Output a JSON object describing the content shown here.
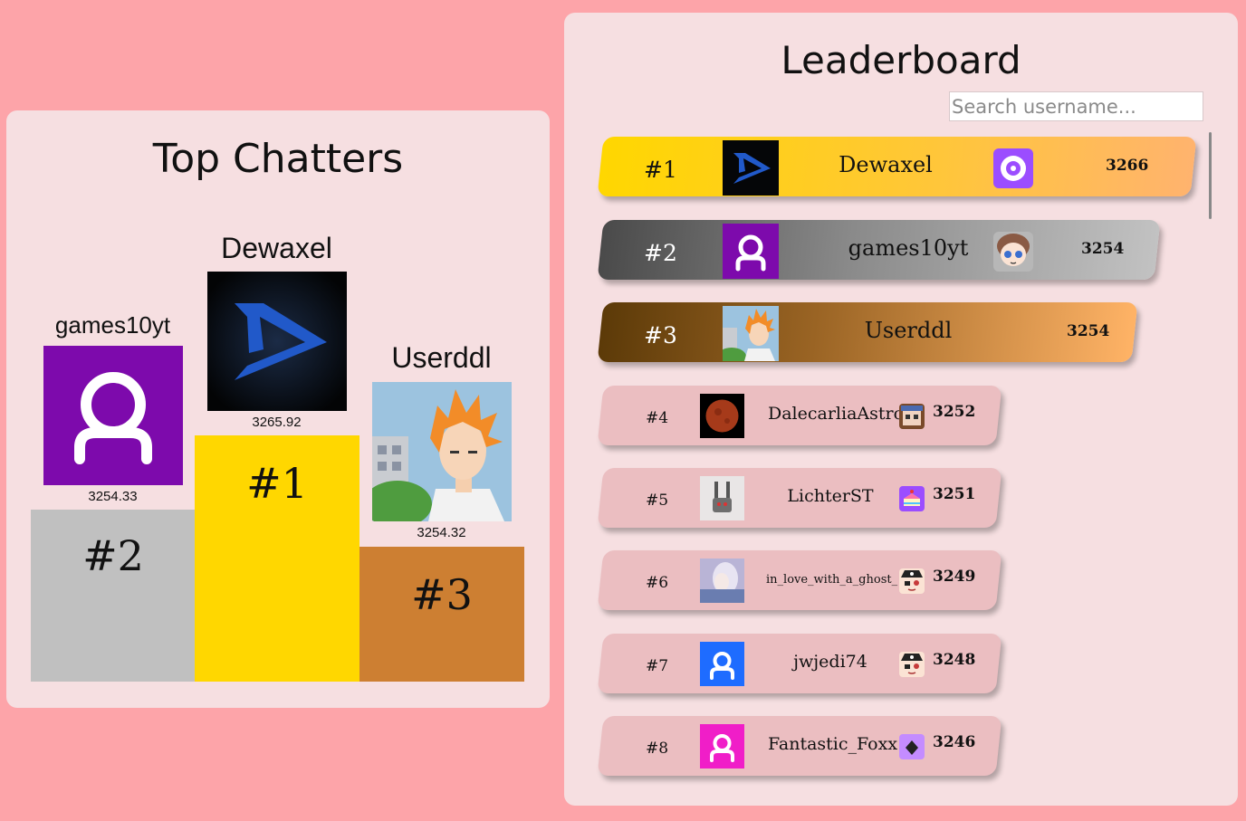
{
  "top_chatters": {
    "title": "Top Chatters",
    "podium": [
      {
        "place": "#2",
        "name": "games10yt",
        "score": "3254.33",
        "block_color": "#c0c0c0"
      },
      {
        "place": "#1",
        "name": "Dewaxel",
        "score": "3265.92",
        "block_color": "#ffd700"
      },
      {
        "place": "#3",
        "name": "Userddl",
        "score": "3254.32",
        "block_color": "#cd7f32"
      }
    ]
  },
  "leaderboard": {
    "title": "Leaderboard",
    "search": {
      "placeholder": "Search username...",
      "value": ""
    },
    "rows": [
      {
        "rank": "#1",
        "username": "Dewaxel",
        "score": "3266",
        "avatar": "dewaxel-logo",
        "badge": "music-disc-icon"
      },
      {
        "rank": "#2",
        "username": "games10yt",
        "score": "3254",
        "avatar": "default-user-purple",
        "badge": "anime-girl-sticker"
      },
      {
        "rank": "#3",
        "username": "Userddl",
        "score": "3254",
        "avatar": "anime-orange-hair"
      },
      {
        "rank": "#4",
        "username": "DalecarliaAstro",
        "score": "3252",
        "avatar": "blood-moon",
        "badge": "pixel-face-sticker"
      },
      {
        "rank": "#5",
        "username": "LichterST",
        "score": "3251",
        "avatar": "robot-figure",
        "badge": "cake-icon"
      },
      {
        "rank": "#6",
        "username": "in_love_with_a_ghost_",
        "score": "3249",
        "avatar": "anime-ghost-girl",
        "badge": "pirate-sticker"
      },
      {
        "rank": "#7",
        "username": "jwjedi74",
        "score": "3248",
        "avatar": "default-user-blue",
        "badge": "pirate-sticker"
      },
      {
        "rank": "#8",
        "username": "Fantastic_Foxx",
        "score": "3246",
        "avatar": "default-user-pink",
        "badge": "diamond-icon"
      }
    ]
  },
  "colors": {
    "page_bg": "#fda4a9",
    "panel_bg": "#f6dfe1",
    "gold": "#ffd700",
    "silver": "#c0c0c0",
    "bronze": "#cd7f32",
    "row_bg": "#ebbec1"
  }
}
